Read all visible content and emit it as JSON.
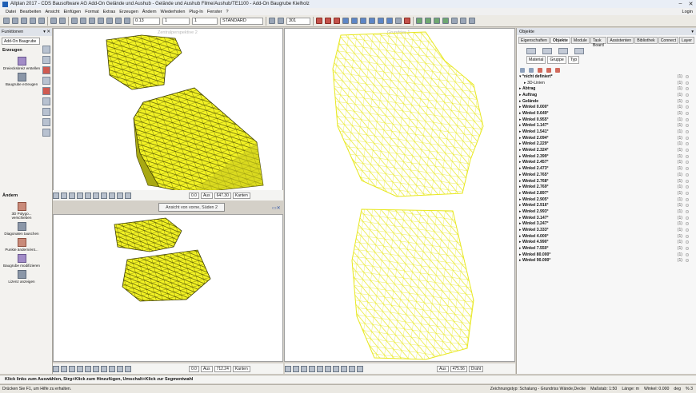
{
  "window": {
    "title": "Allplan 2017 - CDS Bausoftware AG Add-On Gelände und Aushub - Gelände und Aushub Filme/Aushub/TE1100 - Add-On Baugrube Kielholz"
  },
  "menu": {
    "items": [
      "Datei",
      "Bearbeiten",
      "Ansicht",
      "Einfügen",
      "Format",
      "Extras",
      "Erzeugen",
      "Ändern",
      "Wiederholen",
      "Plug-In",
      "Fenster",
      "?"
    ],
    "login": "Login"
  },
  "toolbar": {
    "pen_value": "0.13",
    "line_value": "1",
    "color_value": "1",
    "style_label": "STANDARD",
    "scale_label": "301"
  },
  "left_panel": {
    "title": "Funktionen",
    "selector": "Add-On Baugrube",
    "sections": [
      {
        "label": "Erzeugen",
        "tools": [
          "Dreieckskreiz erstellen",
          "Baugrube erzeugen"
        ]
      },
      {
        "label": "Ändern",
        "tools": [
          "3D Polygo... verschieben",
          "Diagonalen tauschen",
          "Punkte ändern/ent...",
          "Baugrube modifizieren",
          "Lizenz anzeigen"
        ]
      }
    ]
  },
  "viewports": {
    "top_left_title": "Zentralperspektive 2",
    "top_right_title": "Grundriss 1",
    "banner_label": "Ansicht von vorne, Süden 2",
    "bottom_left_title": "Ansicht von vorne, Süden 2",
    "footer_top_left": {
      "scale": "0.0",
      "mode": "Aus",
      "value": "647.30",
      "edges": "Kanten"
    },
    "footer_bottom_left": {
      "scale": "0.0",
      "mode": "Aus",
      "value": "712.24",
      "edges": "Kanten"
    },
    "footer_bottom_right": {
      "mode": "Aus",
      "value": "475.56",
      "edges": "Draht"
    }
  },
  "right_panel": {
    "title": "Objekte",
    "tabs": [
      "Eigenschaften",
      "Objekte",
      "Module",
      "Task Board",
      "Assistenten",
      "Bibliothek",
      "Connect",
      "Layer"
    ],
    "active_tab": "Objekte",
    "subtabs": [
      "Material",
      "Gruppe",
      "Typ"
    ],
    "layers": [
      {
        "label": "*nicht definiert*",
        "count": "(1)",
        "expanded": true
      },
      {
        "label": "3D-Linien",
        "count": "(1)",
        "child": true
      },
      {
        "label": "Abtrag",
        "count": "(1)"
      },
      {
        "label": "Auftrag",
        "count": "(1)"
      },
      {
        "label": "Gelände",
        "count": "(1)"
      },
      {
        "label": "Winkel 0.000°",
        "count": "(1)"
      },
      {
        "label": "Winkel 0.649°",
        "count": "(1)"
      },
      {
        "label": "Winkel 0.955°",
        "count": "(1)"
      },
      {
        "label": "Winkel 1.147°",
        "count": "(1)"
      },
      {
        "label": "Winkel 1.541°",
        "count": "(1)"
      },
      {
        "label": "Winkel 2.094°",
        "count": "(1)"
      },
      {
        "label": "Winkel 2.229°",
        "count": "(1)"
      },
      {
        "label": "Winkel 2.324°",
        "count": "(1)"
      },
      {
        "label": "Winkel 2.399°",
        "count": "(1)"
      },
      {
        "label": "Winkel 2.457°",
        "count": "(1)"
      },
      {
        "label": "Winkel 2.473°",
        "count": "(1)"
      },
      {
        "label": "Winkel 2.765°",
        "count": "(1)"
      },
      {
        "label": "Winkel 2.768°",
        "count": "(1)"
      },
      {
        "label": "Winkel 2.769°",
        "count": "(1)"
      },
      {
        "label": "Winkel 2.897°",
        "count": "(1)"
      },
      {
        "label": "Winkel 2.905°",
        "count": "(1)"
      },
      {
        "label": "Winkel 2.916°",
        "count": "(1)"
      },
      {
        "label": "Winkel 2.993°",
        "count": "(1)"
      },
      {
        "label": "Winkel 3.147°",
        "count": "(1)"
      },
      {
        "label": "Winkel 3.247°",
        "count": "(1)"
      },
      {
        "label": "Winkel 3.333°",
        "count": "(1)"
      },
      {
        "label": "Winkel 4.000°",
        "count": "(1)"
      },
      {
        "label": "Winkel 4.990°",
        "count": "(1)"
      },
      {
        "label": "Winkel 7.550°",
        "count": "(1)"
      },
      {
        "label": "Winkel 80.000°",
        "count": "(1)"
      },
      {
        "label": "Winkel 90.000°",
        "count": "(1)"
      }
    ]
  },
  "hint": "Klick links zum Auswählen, Strg+Klick zum Hinzufügen, Umschalt+Klick zur Segmentwahl",
  "status": {
    "left": "Drücken Sie F1, um Hilfe zu erhalten.",
    "drawing_type": "Zeichnungstyp: Schalung - Grundriss Wände,Decke",
    "scale": "Maßstab: 1:50",
    "length": "Länge: m",
    "angle": "Winkel: 0.000",
    "unit": "deg",
    "percent": "% 3"
  },
  "colors": {
    "mesh": "#f2f224",
    "mesh_stroke": "#3d3d00",
    "accent": "#1f5fb5"
  }
}
